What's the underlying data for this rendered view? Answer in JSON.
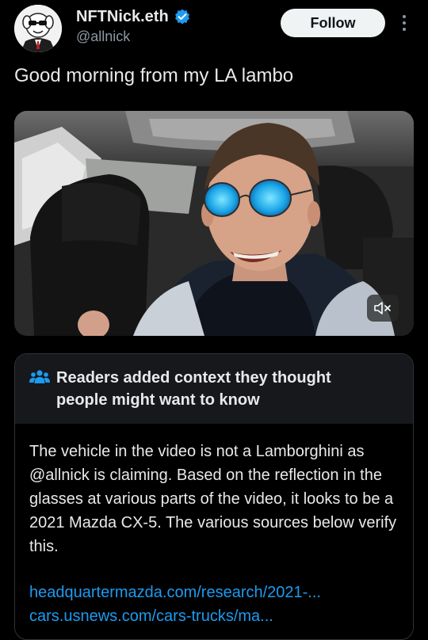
{
  "author": {
    "display_name": "NFTNick.eth",
    "handle": "@allnick",
    "verified": true,
    "avatar": "avatar-illustration"
  },
  "actions": {
    "follow_label": "Follow",
    "more_icon": "more-vertical-icon"
  },
  "tweet": {
    "text": "Good morning from my LA lambo"
  },
  "media": {
    "type": "video",
    "mute_icon": "speaker-muted-icon"
  },
  "community_note": {
    "icon": "people-icon",
    "title": "Readers added context they thought people might want to know",
    "body": "The vehicle in the video is not a Lamborghini as @allnick is claiming. Based on the reflection in the glasses at various parts of the video, it looks to be a 2021 Mazda CX-5. The various sources below verify this.",
    "links": [
      "headquartermazda.com/research/2021-...",
      "cars.usnews.com/cars-trucks/ma..."
    ]
  },
  "colors": {
    "background": "#000000",
    "text": "#e7e9ea",
    "secondary_text": "#8b98a5",
    "accent": "#1d9bf0",
    "note_header_bg": "#16181c",
    "verified_badge": "#1d9bf0"
  }
}
